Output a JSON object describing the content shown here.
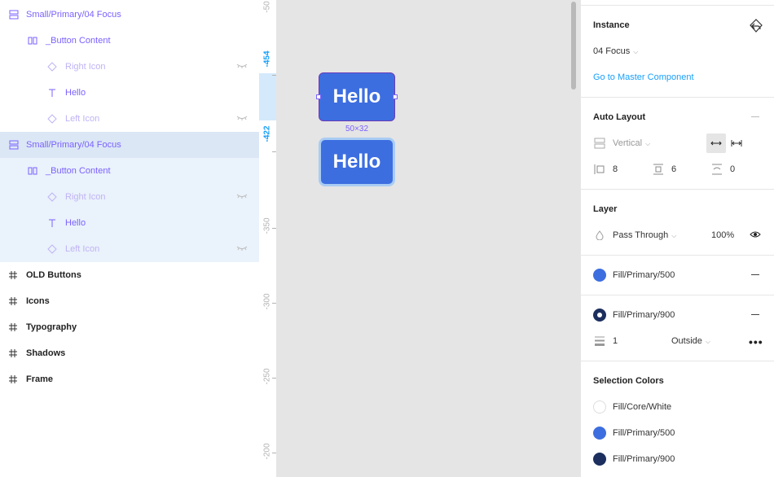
{
  "layers": {
    "rows": [
      {
        "label": "Small/Primary/04 Focus",
        "kind": "component"
      },
      {
        "label": "_Button Content",
        "kind": "frame-h"
      },
      {
        "label": "Right Icon",
        "kind": "instance-hidden"
      },
      {
        "label": "Hello",
        "kind": "text"
      },
      {
        "label": "Left Icon",
        "kind": "instance-hidden"
      },
      {
        "label": "Small/Primary/04 Focus",
        "kind": "component"
      },
      {
        "label": "_Button Content",
        "kind": "frame-h"
      },
      {
        "label": "Right Icon",
        "kind": "instance-hidden"
      },
      {
        "label": "Hello",
        "kind": "text"
      },
      {
        "label": "Left Icon",
        "kind": "instance-hidden"
      },
      {
        "label": "OLD Buttons",
        "kind": "frame"
      },
      {
        "label": "Icons",
        "kind": "frame"
      },
      {
        "label": "Typography",
        "kind": "frame"
      },
      {
        "label": "Shadows",
        "kind": "frame"
      },
      {
        "label": "Frame",
        "kind": "frame"
      }
    ]
  },
  "ruler": {
    "labels": [
      "-50",
      "-454",
      "-422",
      "-350",
      "-300",
      "-250",
      "-200"
    ]
  },
  "canvas": {
    "button_top_text": "Hello",
    "button_bottom_text": "Hello",
    "size_label": "50×32"
  },
  "props": {
    "instance": {
      "title": "Instance",
      "variant": "04 Focus",
      "link": "Go to Master Component"
    },
    "auto_layout": {
      "title": "Auto Layout",
      "direction": "Vertical",
      "spacing": "8",
      "padding_v": "6",
      "padding_h": "0"
    },
    "layer": {
      "title": "Layer",
      "blend": "Pass Through",
      "opacity": "100%"
    },
    "fill": {
      "name": "Fill/Primary/500",
      "color": "#3d6ee0"
    },
    "stroke": {
      "name": "Fill/Primary/900",
      "color": "#1c2f5e",
      "weight": "1",
      "position": "Outside"
    },
    "selection_colors": {
      "title": "Selection Colors",
      "items": [
        {
          "name": "Fill/Core/White",
          "color": "#ffffff"
        },
        {
          "name": "Fill/Primary/500",
          "color": "#3d6ee0"
        },
        {
          "name": "Fill/Primary/900",
          "color": "#1c2f5e"
        }
      ]
    }
  }
}
